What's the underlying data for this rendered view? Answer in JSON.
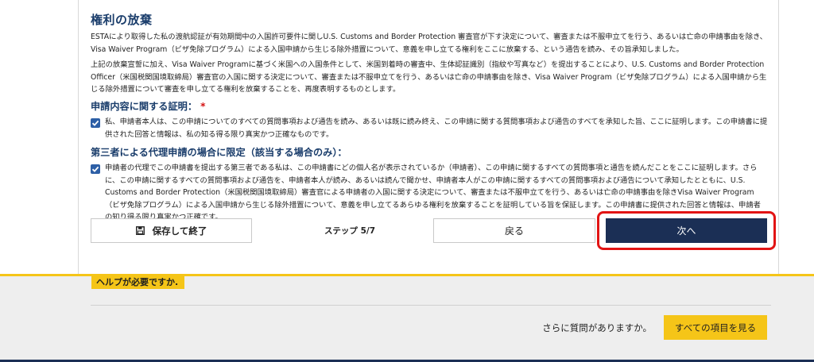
{
  "waiver": {
    "title": "権利の放棄",
    "paragraph1": "ESTAにより取得した私の渡航認証が有効期間中の入国許可要件に関しU.S. Customs and Border Protection 審査官が下す決定について、審査または不服申立てを行う、あるいは亡命の申請事由を除き、Visa Waiver Program（ビザ免除プログラム）による入国申請から生じる除外措置について、意義を申し立てる権利をここに放棄する、という通告を読み、その旨承知しました。",
    "paragraph2": "上記の放棄宣誓に加え、Visa Waiver Programに基づく米国への入国条件として、米国到着時の審査中、生体認証識別（指紋や写真など）を提出することにより、U.S. Customs and Border Protection Officer（米国税関国境取締局）審査官の入国に関する決定について、審査または不服申立てを行う、あるいは亡命の申請事由を除き、Visa Waiver Program（ビザ免除プログラム）による入国申請から生じる除外措置について審査を申し立てる権利を放棄することを、再度表明するものとします。"
  },
  "certification": {
    "heading": "申請内容に関する証明：",
    "required_mark": "*",
    "text": "私、申請者本人は、この申請についてのすべての質問事項および通告を読み、あるいは既に読み終え、この申請に関する質問事項および通告のすべてを承知した旨、ここに証明します。この申請書に提供された回答と情報は、私の知る得る限り真実かつ正確なものです。",
    "checked": true
  },
  "third_party": {
    "heading": "第三者による代理申請の場合に限定（該当する場合のみ）：",
    "text": "申請者の代理でこの申請書を提出する第三者である私は、この申請書にどの個人名が表示されているか（申請者）、この申請に関するすべての質問事項と通告を読んだことをここに証明します。さらに、この申請に関するすべての質問事項および通告を、申請者本人が読み、あるいは読んで聞かせ、申請者本人がこの申請に関するすべての質問事項および通告について承知したとともに、U.S. Customs and Border Protection（米国税関国境取締局）審査官による申請者の入国に関する決定について、審査または不服申立てを行う、あるいは亡命の申請事由を除きVisa Waiver Program（ビザ免除プログラム）による入国申請から生じる除外措置について、意義を申し立てるあらゆる権利を放棄することを証明している旨を保証します。この申請書に提供された回答と情報は、申請者の知り得る限り真実かつ正確です。",
    "checked": true
  },
  "nav": {
    "save_label": "保存して終了",
    "step_label": "ステップ 5/7",
    "back_label": "戻る",
    "next_label": "次へ"
  },
  "footer": {
    "help_badge": "ヘルプが必要ですか.",
    "question": "さらに質問がありますか。",
    "all_items_button": "すべての項目を見る"
  },
  "colors": {
    "heading": "#1a3d6b",
    "primary_button": "#1b2f55",
    "highlight_outline": "#e21414",
    "accent_yellow": "#f5c518",
    "checkbox": "#2d5fa6"
  },
  "icons": {
    "save": "floppy-disk-icon",
    "checkbox": "checkmark-icon"
  }
}
